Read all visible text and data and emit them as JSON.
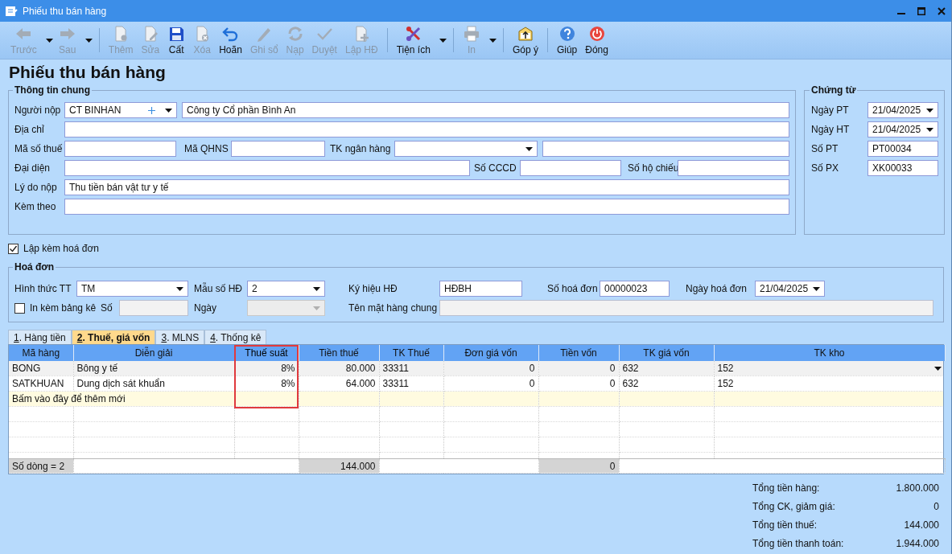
{
  "window": {
    "title": "Phiếu thu bán hàng"
  },
  "toolbar": [
    [
      {
        "label": "Trước",
        "disabled": true,
        "dropdown": true
      },
      {
        "label": "Sau",
        "disabled": true,
        "dropdown": true
      }
    ],
    [
      {
        "label": "Thêm",
        "disabled": true,
        "dropdown": false
      },
      {
        "label": "Sửa",
        "disabled": true,
        "dropdown": false
      },
      {
        "label": "Cất",
        "disabled": false,
        "dropdown": false
      },
      {
        "label": "Xóa",
        "disabled": true,
        "dropdown": false
      },
      {
        "label": "Hoãn",
        "disabled": false,
        "dropdown": false
      },
      {
        "label": "Ghi sổ",
        "disabled": true,
        "dropdown": false
      },
      {
        "label": "Nạp",
        "disabled": true,
        "dropdown": false
      },
      {
        "label": "Duyệt",
        "disabled": true,
        "dropdown": false
      },
      {
        "label": "Lập HĐ",
        "disabled": true,
        "dropdown": false
      }
    ],
    [
      {
        "label": "Tiện ích",
        "disabled": false,
        "dropdown": true
      }
    ],
    [
      {
        "label": "In",
        "disabled": true,
        "dropdown": true
      }
    ],
    [
      {
        "label": "Góp ý",
        "disabled": false,
        "dropdown": false
      }
    ],
    [
      {
        "label": "Giúp",
        "disabled": false,
        "dropdown": false
      },
      {
        "label": "Đóng",
        "disabled": false,
        "dropdown": false
      }
    ]
  ],
  "form_title": "Phiếu thu bán hàng",
  "general": {
    "title": "Thông tin chung",
    "payer": {
      "label": "Người nộp",
      "code": "CT BINHAN",
      "name": "Công ty Cổ phần Bình An"
    },
    "address": {
      "label": "Địa chỉ"
    },
    "tax_code": {
      "label": "Mã số thuế"
    },
    "budget_code": {
      "label": "Mã QHNS"
    },
    "bank_account": {
      "label": "TK ngân hàng"
    },
    "representative": {
      "label": "Đại diện"
    },
    "id_number": {
      "label": "Số CCCD"
    },
    "passport": {
      "label": "Số hộ chiếu"
    },
    "reason": {
      "label": "Lý do nộp",
      "value": "Thu tiền bán vật tư y tế"
    },
    "attached": {
      "label": "Kèm theo"
    }
  },
  "voucher": {
    "title": "Chứng từ",
    "fields": [
      {
        "label": "Ngày PT",
        "value": "21/04/2025",
        "kind": "date"
      },
      {
        "label": "Ngày HT",
        "value": "21/04/2025",
        "kind": "date"
      },
      {
        "label": "Số PT",
        "value": "PT00034",
        "kind": "text"
      },
      {
        "label": "Số PX",
        "value": "XK00033",
        "kind": "text"
      }
    ]
  },
  "with_invoice": {
    "label": "Lập kèm hoá đơn",
    "checked": true
  },
  "invoice": {
    "title": "Hoá đơn",
    "payment_method": {
      "label": "Hình thức TT",
      "value": "TM"
    },
    "template": {
      "label": "Mẫu số HĐ",
      "value": "2"
    },
    "symbol": {
      "label": "Ký hiệu HĐ",
      "value": "HĐBH"
    },
    "number": {
      "label": "Số hoá đơn",
      "value": "00000023"
    },
    "date": {
      "label": "Ngày hoá đơn",
      "value": "21/04/2025"
    },
    "print_list": {
      "label": "In kèm bảng kê",
      "checked": false
    },
    "list_number": {
      "label": "Số"
    },
    "list_date": {
      "label": "Ngày",
      "disabled": true
    },
    "common_name": {
      "label": "Tên mặt hàng chung"
    }
  },
  "tabs": [
    {
      "label": "1. Hàng tiền",
      "selected": false
    },
    {
      "label": "2. Thuế, giá vốn",
      "selected": true
    },
    {
      "label": "3. MLNS",
      "selected": false
    },
    {
      "label": "4. Thống kê",
      "selected": false
    }
  ],
  "table": {
    "columns": [
      {
        "label": "Mã hàng",
        "highlighted": false
      },
      {
        "label": "Diễn giải",
        "highlighted": false
      },
      {
        "label": "Thuế suất",
        "highlighted": true
      },
      {
        "label": "Tiền thuế",
        "highlighted": false
      },
      {
        "label": "TK Thuế",
        "highlighted": false
      },
      {
        "label": "Đơn giá vốn",
        "highlighted": false
      },
      {
        "label": "Tiền vốn",
        "highlighted": false
      },
      {
        "label": "TK giá vốn",
        "highlighted": false
      },
      {
        "label": "TK kho",
        "highlighted": false
      }
    ],
    "rows": [
      {
        "cells": [
          "BONG",
          "Bông y tế",
          "8%",
          "80.000",
          "33311",
          "0",
          "0",
          "632",
          "152"
        ],
        "selected": true
      },
      {
        "cells": [
          "SATKHUAN",
          "Dung dịch sát khuẩn",
          "8%",
          "64.000",
          "33311",
          "0",
          "0",
          "632",
          "152"
        ],
        "selected": false
      }
    ],
    "add_row_hint": "Bấm vào đây để thêm mới",
    "footer": {
      "row_count": "Số dòng = 2",
      "tax_total": "144.000",
      "cost_total": "0"
    }
  },
  "totals": [
    {
      "label": "Tổng tiền hàng:",
      "value": "1.800.000"
    },
    {
      "label": "Tổng CK, giảm giá:",
      "value": "0"
    },
    {
      "label": "Tổng tiền thuế:",
      "value": "144.000"
    },
    {
      "label": "Tổng tiền thanh toán:",
      "value": "1.944.000"
    }
  ]
}
